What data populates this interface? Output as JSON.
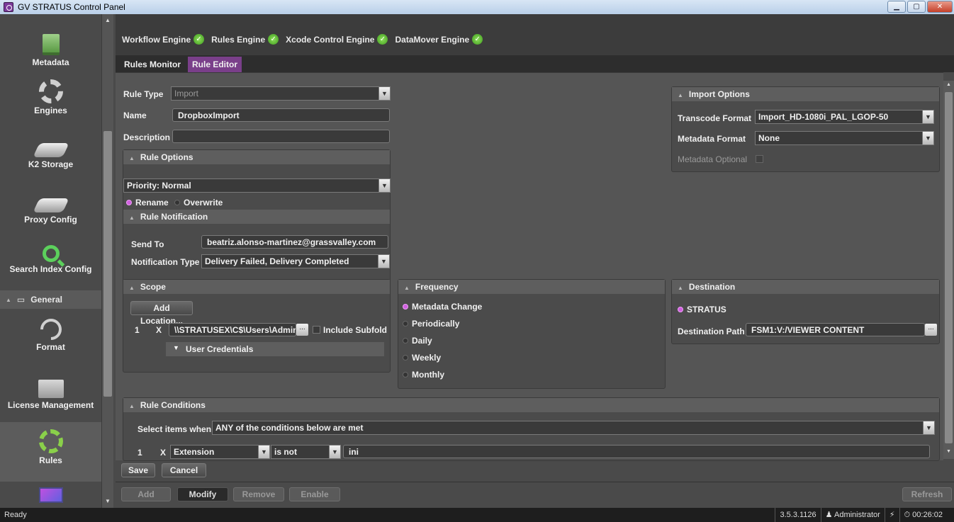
{
  "window": {
    "title": "GV STRATUS Control Panel",
    "minimize": "▁",
    "maximize": "▢",
    "close": "✕"
  },
  "sidebar": {
    "items": [
      {
        "label": "Metadata",
        "icon": "metadata-icon"
      },
      {
        "label": "Engines",
        "icon": "gear-icon"
      },
      {
        "label": "K2 Storage",
        "icon": "disk-icon"
      },
      {
        "label": "Proxy Config",
        "icon": "disk-icon"
      },
      {
        "label": "Search Index Config",
        "icon": "search-icon"
      },
      {
        "label": "Format",
        "icon": "wrench-icon"
      },
      {
        "label": "License Management",
        "icon": "folder-icon"
      },
      {
        "label": "Rules",
        "icon": "gears-icon"
      }
    ],
    "group": "General"
  },
  "engines": [
    "Workflow Engine",
    "Rules Engine",
    "Xcode Control Engine",
    "DataMover Engine"
  ],
  "tabs": [
    "Rules Monitor",
    "Rule Editor"
  ],
  "form": {
    "rule_type_label": "Rule Type",
    "rule_type_value": "Import",
    "name_label": "Name",
    "name_value": "DropboxImport",
    "description_label": "Description",
    "description_value": ""
  },
  "rule_options": {
    "title": "Rule Options",
    "priority": "Priority: Normal",
    "rename": "Rename",
    "overwrite": "Overwrite"
  },
  "rule_notification": {
    "title": "Rule Notification",
    "send_to_label": "Send To",
    "send_to_value": "beatriz.alonso-martinez@grassvalley.com",
    "type_label": "Notification Type",
    "type_value": "Delivery Failed, Delivery Completed"
  },
  "scope": {
    "title": "Scope",
    "add_location": "Add Location...",
    "row_index": "1",
    "row_remove": "X",
    "path": "\\\\STRATUSEX\\C$\\Users\\Administr",
    "browse": "...",
    "include_subfolders": "Include Subfold",
    "credentials": "User Credentials"
  },
  "frequency": {
    "title": "Frequency",
    "options": [
      "Metadata Change",
      "Periodically",
      "Daily",
      "Weekly",
      "Monthly"
    ]
  },
  "import_options": {
    "title": "Import Options",
    "transcode_label": "Transcode Format",
    "transcode_value": "Import_HD-1080i_PAL_LGOP-50",
    "metadata_label": "Metadata Format",
    "metadata_value": "None",
    "metadata_optional_label": "Metadata Optional"
  },
  "destination": {
    "title": "Destination",
    "stratus": "STRATUS",
    "path_label": "Destination Path",
    "path_value": "FSM1:V:/VIEWER CONTENT",
    "browse": "..."
  },
  "conditions": {
    "title": "Rule Conditions",
    "select_label": "Select items when:",
    "select_value": "ANY of the conditions below are met",
    "row_index": "1",
    "row_remove": "X",
    "field": "Extension",
    "operator": "is not",
    "value": "ini"
  },
  "actions": {
    "save": "Save",
    "cancel": "Cancel"
  },
  "bottom": {
    "add": "Add",
    "modify": "Modify",
    "remove": "Remove",
    "enable": "Enable",
    "refresh": "Refresh"
  },
  "status": {
    "text": "Ready",
    "version": "3.5.3.1126",
    "user": "Administrator",
    "timer": "00:26:02"
  }
}
